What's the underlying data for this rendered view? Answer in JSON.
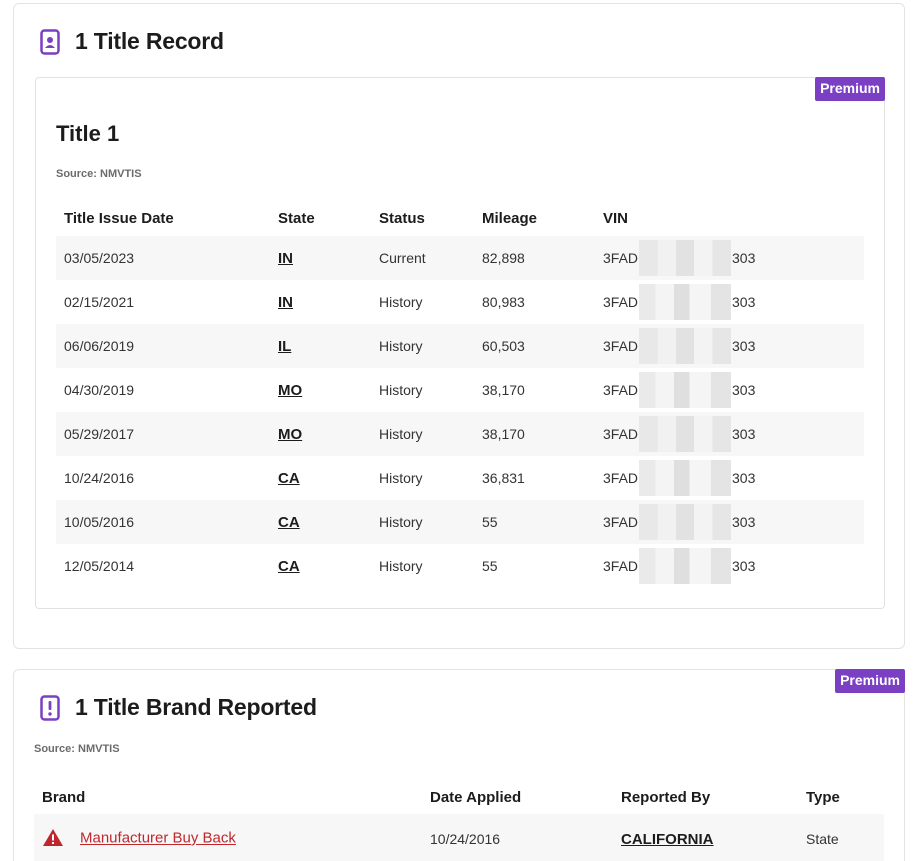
{
  "colors": {
    "accent": "#7b3fc4",
    "brand_link": "#c0272d",
    "row_alt": "#f7f7f7"
  },
  "records_section": {
    "heading": "1 Title Record",
    "icon": "title-record-icon",
    "title": {
      "name": "Title 1",
      "badge": "Premium",
      "source": "Source: NMVTIS",
      "columns": [
        "Title Issue Date",
        "State",
        "Status",
        "Mileage",
        "VIN"
      ],
      "rows": [
        {
          "date": "03/05/2023",
          "state": "IN",
          "status": "Current",
          "mileage": "82,898",
          "vin_start": "3FAD",
          "vin_end": "303"
        },
        {
          "date": "02/15/2021",
          "state": "IN",
          "status": "History",
          "mileage": "80,983",
          "vin_start": "3FAD",
          "vin_end": "303"
        },
        {
          "date": "06/06/2019",
          "state": "IL",
          "status": "History",
          "mileage": "60,503",
          "vin_start": "3FAD",
          "vin_end": "303"
        },
        {
          "date": "04/30/2019",
          "state": "MO",
          "status": "History",
          "mileage": "38,170",
          "vin_start": "3FAD",
          "vin_end": "303"
        },
        {
          "date": "05/29/2017",
          "state": "MO",
          "status": "History",
          "mileage": "38,170",
          "vin_start": "3FAD",
          "vin_end": "303"
        },
        {
          "date": "10/24/2016",
          "state": "CA",
          "status": "History",
          "mileage": "36,831",
          "vin_start": "3FAD",
          "vin_end": "303"
        },
        {
          "date": "10/05/2016",
          "state": "CA",
          "status": "History",
          "mileage": "55",
          "vin_start": "3FAD",
          "vin_end": "303"
        },
        {
          "date": "12/05/2014",
          "state": "CA",
          "status": "History",
          "mileage": "55",
          "vin_start": "3FAD",
          "vin_end": "303"
        }
      ]
    }
  },
  "brands_section": {
    "heading": "1 Title Brand Reported",
    "icon": "title-brand-alert-icon",
    "badge": "Premium",
    "source": "Source: NMVTIS",
    "columns": [
      "Brand",
      "Date Applied",
      "Reported By",
      "Type"
    ],
    "rows": [
      {
        "brand": "Manufacturer Buy Back",
        "date": "10/24/2016",
        "reported_by": "CALIFORNIA",
        "type": "State"
      }
    ]
  }
}
